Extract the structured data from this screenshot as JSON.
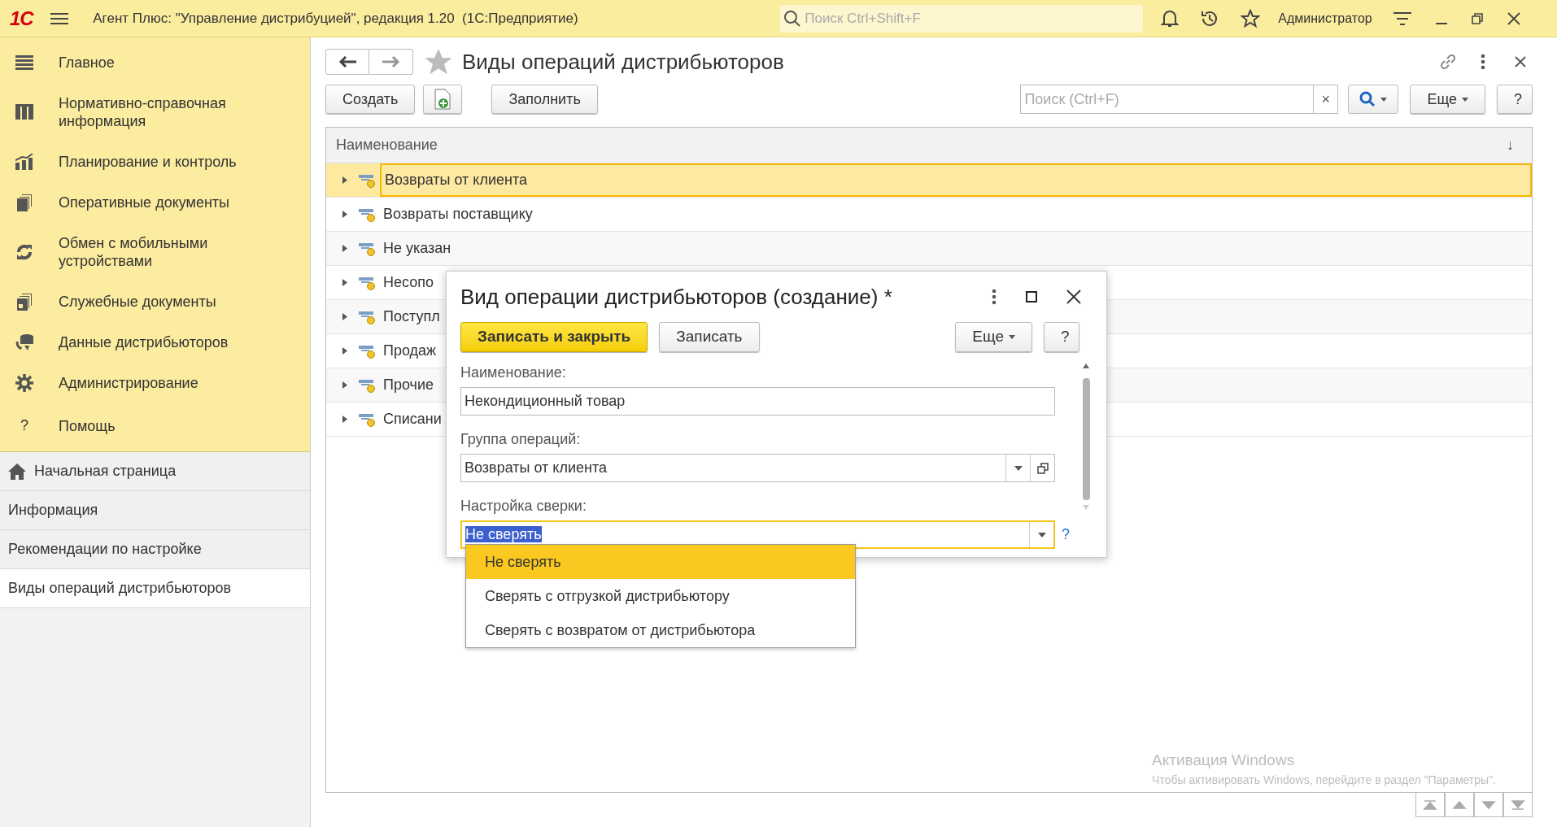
{
  "app_bar": {
    "logo": "1С",
    "title": "Агент Плюс: \"Управление дистрибуцией\", редакция 1.20  (1С:Предприятие)",
    "search_placeholder": "Поиск Ctrl+Shift+F",
    "user": "Администратор"
  },
  "sidebar": {
    "sections": [
      {
        "label": "Главное"
      },
      {
        "label": "Нормативно-справочная информация"
      },
      {
        "label": "Планирование и контроль"
      },
      {
        "label": "Оперативные документы"
      },
      {
        "label": "Обмен с мобильными устройствами"
      },
      {
        "label": "Служебные документы"
      },
      {
        "label": "Данные дистрибьюторов"
      },
      {
        "label": "Администрирование"
      },
      {
        "label": "Помощь",
        "glyph": "?"
      }
    ],
    "open_pages": [
      {
        "label": "Начальная страница",
        "kind": "home",
        "selected": false
      },
      {
        "label": "Информация",
        "kind": "page",
        "selected": false
      },
      {
        "label": "Рекомендации по настройке",
        "kind": "page",
        "selected": false
      },
      {
        "label": "Виды операций дистрибьюторов",
        "kind": "page",
        "selected": true
      }
    ]
  },
  "page": {
    "title": "Виды операций дистрибьюторов",
    "create": "Создать",
    "fill": "Заполнить",
    "search_placeholder": "Поиск (Ctrl+F)",
    "clear": "×",
    "more": "Еще",
    "help": "?"
  },
  "table": {
    "columns": [
      "Наименование"
    ],
    "sort_mark": "↓",
    "rows": [
      {
        "name": "Возвраты от клиента",
        "selected": true
      },
      {
        "name": "Возвраты поставщику",
        "selected": false
      },
      {
        "name": "Не указан",
        "selected": false
      },
      {
        "name": "Несопо",
        "selected": false
      },
      {
        "name": "Поступл",
        "selected": false
      },
      {
        "name": "Продаж",
        "selected": false
      },
      {
        "name": "Прочие",
        "selected": false
      },
      {
        "name": "Списани",
        "selected": false
      }
    ]
  },
  "dialog": {
    "title": "Вид операции дистрибьюторов (создание) *",
    "buttons": [
      {
        "label": "Записать и закрыть",
        "kind": "primary"
      },
      {
        "label": "Записать",
        "kind": "normal"
      }
    ],
    "more": "Еще",
    "help": "?",
    "fields": [
      {
        "label": "Наименование:",
        "value": "Некондиционный товар",
        "kind": "text",
        "focused": false
      },
      {
        "label": "Группа операций:",
        "value": "Возвраты от клиента",
        "kind": "select_open",
        "focused": false
      },
      {
        "label": "Настройка сверки:",
        "value": "Не сверять",
        "kind": "select",
        "focused": true,
        "hint": "?"
      }
    ],
    "dropdown": [
      {
        "label": "Не сверять",
        "selected": true
      },
      {
        "label": "Сверять с отгрузкой дистрибьютору",
        "selected": false
      },
      {
        "label": "Сверять с возвратом от дистрибьютора",
        "selected": false
      }
    ]
  },
  "activation_notice": {
    "title": "Активация Windows",
    "text": "Чтобы активировать Windows, перейдите в раздел \"Параметры\"."
  }
}
